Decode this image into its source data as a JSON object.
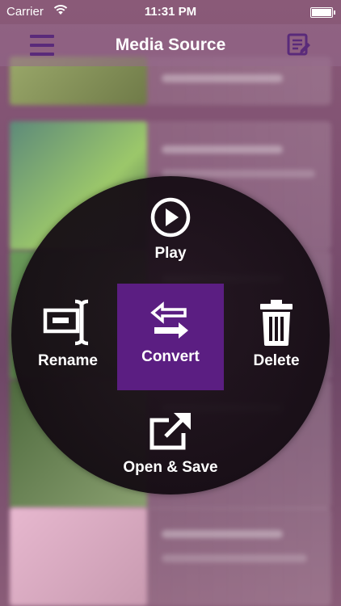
{
  "status_bar": {
    "carrier": "Carrier",
    "time": "11:31 PM"
  },
  "nav": {
    "title": "Media Source",
    "menu_icon": "hamburger-icon",
    "edit_icon": "edit-list-icon"
  },
  "context_menu": {
    "play_label": "Play",
    "rename_label": "Rename",
    "convert_label": "Convert",
    "delete_label": "Delete",
    "open_save_label": "Open & Save"
  },
  "colors": {
    "accent": "#5b1e82",
    "nav_icon": "#5a2a7a"
  }
}
